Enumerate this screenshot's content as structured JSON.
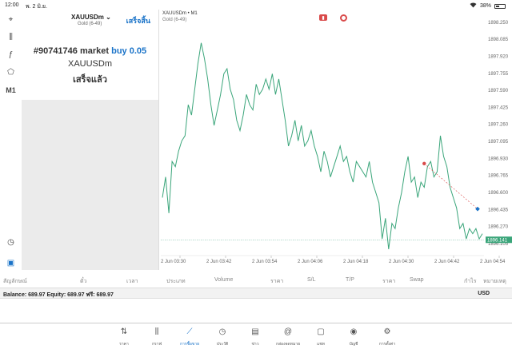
{
  "status_bar": {
    "time": "12:00",
    "date": "พ. 2 มิ.ย.",
    "wifi": "wifi-icon",
    "battery": "38%",
    "battery_level": 0.38
  },
  "left_toolbar": [
    {
      "name": "crosshair-icon",
      "glyph": "⌖"
    },
    {
      "name": "indicators-icon",
      "glyph": "⫼"
    },
    {
      "name": "function-icon",
      "glyph": "ƒ"
    },
    {
      "name": "objects-icon",
      "glyph": "⬠"
    },
    {
      "name": "timeframe-m1",
      "glyph": "M1"
    },
    {
      "name": "speedometer-icon",
      "glyph": "◷"
    },
    {
      "name": "trade-panel-icon",
      "glyph": "▣"
    }
  ],
  "order_panel": {
    "symbol": "XAUUSDm",
    "symbol_desc": "Gold (6-49)",
    "done_label": "เสร็จสิ้น",
    "order_id": "#90741746",
    "order_type": "market",
    "order_side": "buy 0.05",
    "order_symbol": "XAUUSDm",
    "order_status": "เสร็จแล้ว"
  },
  "chart": {
    "title": "XAUUSDm • M1",
    "subtitle": "Gold (6-49)",
    "colors": {
      "line": "#3aa57a",
      "current": "#3aa57a",
      "entry": "#d94a4a",
      "target": "#1a73c8",
      "axis_text": "#666"
    }
  },
  "chart_data": {
    "type": "line",
    "x_labels": [
      "2 Jun 03:30",
      "2 Jun 03:42",
      "2 Jun 03:54",
      "2 Jun 04:06",
      "2 Jun 04:18",
      "2 Jun 04:30",
      "2 Jun 04:42",
      "2 Jun 04:54"
    ],
    "y_ticks": [
      "1898.250",
      "1898.085",
      "1897.920",
      "1897.755",
      "1897.590",
      "1897.425",
      "1897.260",
      "1897.095",
      "1896.930",
      "1896.765",
      "1896.600",
      "1896.435",
      "1896.270",
      "1896.105"
    ],
    "current_price": "1896.141",
    "ylim": [
      1896.05,
      1898.28
    ],
    "series": [
      {
        "values": [
          1896.55,
          1896.75,
          1896.4,
          1896.9,
          1896.85,
          1897.0,
          1897.1,
          1897.15,
          1897.45,
          1897.35,
          1897.6,
          1897.85,
          1898.05,
          1897.9,
          1897.7,
          1897.45,
          1897.25,
          1897.4,
          1897.55,
          1897.75,
          1897.8,
          1897.6,
          1897.5,
          1897.3,
          1897.2,
          1897.35,
          1897.55,
          1897.45,
          1897.4,
          1897.65,
          1897.55,
          1897.6,
          1897.7,
          1897.6,
          1897.75,
          1897.55,
          1897.7,
          1897.5,
          1897.3,
          1897.05,
          1897.15,
          1897.3,
          1897.1,
          1897.25,
          1897.05,
          1897.1,
          1897.2,
          1897.05,
          1896.95,
          1896.8,
          1897.0,
          1896.9,
          1896.75,
          1896.85,
          1896.95,
          1897.05,
          1896.9,
          1896.95,
          1896.8,
          1896.7,
          1896.9,
          1896.85,
          1896.8,
          1896.75,
          1896.9,
          1896.7,
          1896.6,
          1896.5,
          1896.15,
          1896.35,
          1896.05,
          1896.3,
          1896.25,
          1896.45,
          1896.6,
          1896.8,
          1896.95,
          1896.7,
          1896.75,
          1896.55,
          1896.7,
          1896.65,
          1896.85,
          1896.9,
          1896.75,
          1896.8,
          1897.15,
          1896.95,
          1896.85,
          1896.65,
          1896.55,
          1896.45,
          1896.25,
          1896.3,
          1896.15,
          1896.25,
          1896.2,
          1896.25,
          1896.15,
          1896.2
        ]
      }
    ],
    "entry_marker": 1896.88,
    "target_marker": 1896.44
  },
  "positions_table": {
    "headers": [
      "สัญลักษณ์",
      "ตั๋ว",
      "เวลา",
      "ประเภท",
      "Volume",
      "ราคา",
      "S/L",
      "T/P",
      "ราคา",
      "Swap",
      "กำไร",
      "หมายเหตุ"
    ]
  },
  "balance_row": {
    "text": "Balance: 689.97 Equity: 689.97 ฟรี: 689.97",
    "currency": "USD"
  },
  "bottom_nav": [
    {
      "name": "nav-quotes",
      "icon": "quotes-icon",
      "glyph": "⇅",
      "label": "ราคา"
    },
    {
      "name": "nav-charts",
      "icon": "chart-icon",
      "glyph": "⫼",
      "label": "กราฟ"
    },
    {
      "name": "nav-trade",
      "icon": "trade-icon",
      "glyph": "⟋",
      "label": "การซื้อขาย",
      "active": true
    },
    {
      "name": "nav-history",
      "icon": "history-icon",
      "glyph": "◷",
      "label": "ประวัติ"
    },
    {
      "name": "nav-news",
      "icon": "news-icon",
      "glyph": "▤",
      "label": "ข่าว"
    },
    {
      "name": "nav-mailbox",
      "icon": "mail-icon",
      "glyph": "@",
      "label": "กล่องจดหมาย"
    },
    {
      "name": "nav-chat",
      "icon": "chat-icon",
      "glyph": "▢",
      "label": "แชท"
    },
    {
      "name": "nav-account",
      "icon": "account-icon",
      "glyph": "◉",
      "label": "บัญชี"
    },
    {
      "name": "nav-settings",
      "icon": "gear-icon",
      "glyph": "⚙",
      "label": "การตั้งค่า"
    }
  ]
}
